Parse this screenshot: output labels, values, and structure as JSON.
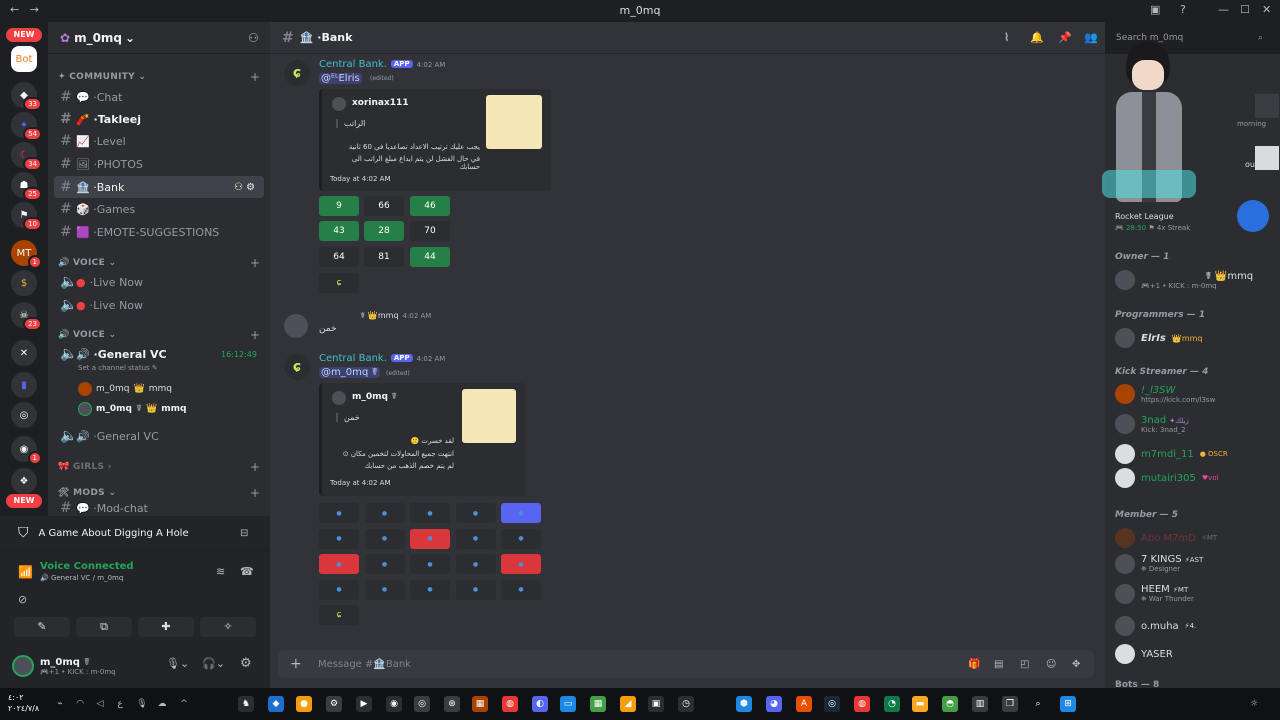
{
  "window": {
    "title": "m_0mq"
  },
  "guilds": {
    "new_badge": "NEW",
    "badges": [
      "33",
      "54",
      "34",
      "25",
      "10",
      "1",
      "23",
      "1"
    ],
    "bottom_new": "NEW",
    "icon_labels": [
      "Bot",
      "MT"
    ]
  },
  "server": {
    "name": "m_0mq"
  },
  "channels": {
    "community_cat": "COMMUNITY",
    "items": [
      {
        "label": "Chat"
      },
      {
        "label": "Takleej"
      },
      {
        "label": "Level"
      },
      {
        "label": "PHOTOS"
      },
      {
        "label": "Bank"
      },
      {
        "label": "Games"
      },
      {
        "label": "EMOTE-SUGGESTIONS"
      }
    ],
    "voice_cat1": "VOICE",
    "live1": "Live Now",
    "live2": "Live Now",
    "voice_cat2": "VOICE",
    "general_vc": "General VC",
    "vc_timer": "16:12:49",
    "set_status": "Set a channel status",
    "vc_users": [
      {
        "name": "m_0mq",
        "tag": "mmq"
      },
      {
        "name": "m_0mq",
        "tag": "mmq"
      }
    ],
    "general_vc2": "General VC",
    "girls_cat": "GIRLS",
    "mods_cat": "MODS",
    "mod_chat": "Mod-chat"
  },
  "game_activity": "A Game About Digging A Hole",
  "voice": {
    "status": "Voice Connected",
    "location": "General VC / m_0mq"
  },
  "user": {
    "name": "m_0mq",
    "status": "KICK : m-0mq"
  },
  "header": {
    "channel": "Bank",
    "search_placeholder": "Search m_0mq"
  },
  "messages": [
    {
      "author": "Central Bank.",
      "app": "APP",
      "time": "4:02 AM",
      "mention": "@ᴱᴸElris",
      "edited": "(edited)",
      "embed": {
        "user": "xorinax111",
        "line1": "الراتب",
        "line2": "يجب عليك ترتيب الاعداد تصاعديا في 60 ثانية",
        "line3": "في حال الفشل لن يتم ايداع مبلغ الراتب الى حسابك",
        "footer": "Today at 4:02 AM"
      },
      "buttons": [
        [
          "9",
          "66",
          "46"
        ],
        [
          "43",
          "28",
          "70"
        ],
        [
          "64",
          "81",
          "44"
        ]
      ]
    },
    {
      "author": "mmq",
      "time": "4:02 AM",
      "text": "خمن"
    },
    {
      "author": "Central Bank.",
      "app": "APP",
      "time": "4:02 AM",
      "mention": "@m_0mq",
      "edited": "(edited)",
      "embed": {
        "user": "m_0mq",
        "line1": "خمن",
        "line2": "لقد خسرت",
        "line3": "انتهت جميع المحاولات لتخمين مكان",
        "line4": "لم يتم خصم الذهب من حسابك",
        "footer": "Today at 4:02 AM"
      }
    }
  ],
  "composer": {
    "placeholder": "Message #🏦Bank"
  },
  "members": {
    "activity": {
      "game": "Rocket League",
      "time": "28:50",
      "streak": "4x Streak",
      "morning": "morning",
      "sound": "ound"
    },
    "owner_cat": "Owner — 1",
    "owner": {
      "name": "mmq",
      "sub": "KICK : m-0mq"
    },
    "prog_cat": "Programmers — 1",
    "prog": {
      "name": "ElrIs",
      "tag": "mmq"
    },
    "kick_cat": "Kick Streamer — 4",
    "kick": [
      {
        "name": "!_l3SW",
        "sub": "https://kick.com/l3sw"
      },
      {
        "name": "3nad",
        "tag": "زيلك",
        "sub": "Kick: 3nad_2"
      },
      {
        "name": "m7mdi_11",
        "tag": "OSCR"
      },
      {
        "name": "mutairi305",
        "tag": "vol"
      }
    ],
    "member_cat": "Member — 5",
    "member": [
      {
        "name": "Abo M7mD",
        "tag": "MT"
      },
      {
        "name": "7 KINGS",
        "tag": "AST",
        "sub": "Designer"
      },
      {
        "name": "HEEM",
        "tag": "MT",
        "sub": "War Thunder"
      },
      {
        "name": "o.muha",
        "tag": "4."
      },
      {
        "name": "YASER"
      }
    ],
    "bots_cat": "Bots — 8"
  },
  "taskbar": {
    "time": "٤:٠٢",
    "date": "٢٠٢٤/٧/٨"
  }
}
